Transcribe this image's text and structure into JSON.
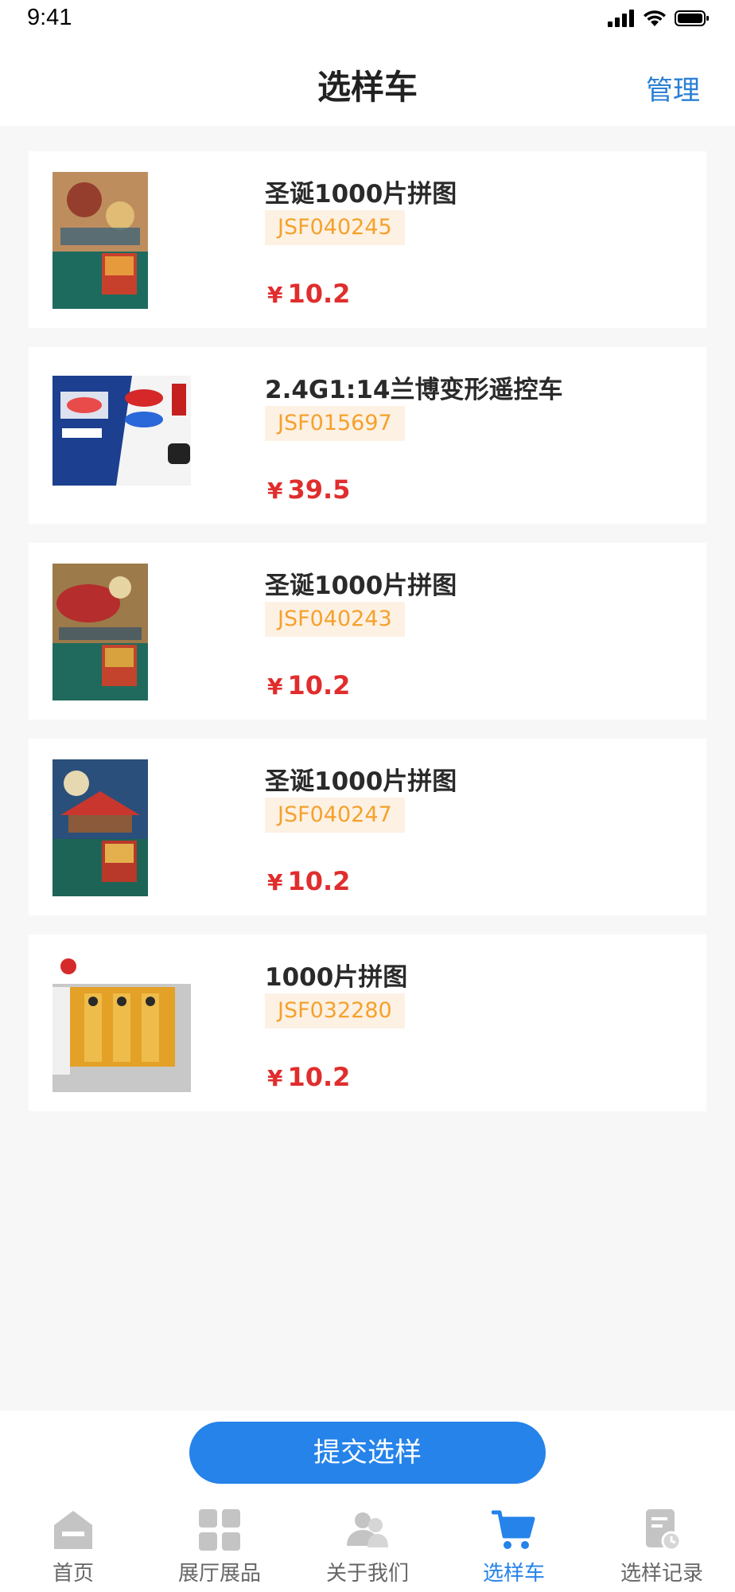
{
  "status_bar": {
    "time": "9:41"
  },
  "nav": {
    "title": "选样车",
    "action": "管理"
  },
  "items": [
    {
      "title": "圣诞1000片拼图",
      "code": "JSF040245",
      "price_symbol": "¥",
      "price": "10.2"
    },
    {
      "title": "2.4G1:14兰博变形遥控车",
      "code": "JSF015697",
      "price_symbol": "¥",
      "price": "39.5"
    },
    {
      "title": "圣诞1000片拼图",
      "code": "JSF040243",
      "price_symbol": "¥",
      "price": "10.2"
    },
    {
      "title": "圣诞1000片拼图",
      "code": "JSF040247",
      "price_symbol": "¥",
      "price": "10.2"
    },
    {
      "title": "1000片拼图",
      "code": "JSF032280",
      "price_symbol": "¥",
      "price": "10.2"
    }
  ],
  "submit": {
    "label": "提交选样"
  },
  "tabs": [
    {
      "label": "首页",
      "icon": "home-icon",
      "active": false
    },
    {
      "label": "展厅展品",
      "icon": "grid-icon",
      "active": false
    },
    {
      "label": "关于我们",
      "icon": "people-icon",
      "active": false
    },
    {
      "label": "选样车",
      "icon": "cart-icon",
      "active": true
    },
    {
      "label": "选样记录",
      "icon": "record-icon",
      "active": false
    }
  ],
  "colors": {
    "accent": "#2583ea",
    "price": "#e02d2d",
    "code_text": "#f5a12c",
    "code_bg": "#fdf1e4",
    "tab_inactive": "#c4c4c4"
  }
}
